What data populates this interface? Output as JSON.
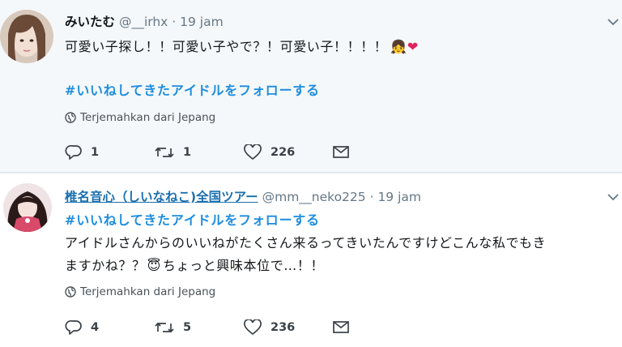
{
  "tweets": [
    {
      "display_name": "みいたむ",
      "handle": "@__irhx",
      "time": "· 19 jam",
      "text_line1": "可愛い子探し！！可愛い子やで？！可愛い子！！！！",
      "emoji_line1": "👧❤",
      "hashtag": "#いいねしてきたアイドルをフォローする",
      "translate_label": "Terjemahkan dari Jepang",
      "replies": "1",
      "retweets": "1",
      "likes": "226"
    },
    {
      "display_name": "椎名音心（しいなねこ)全国ツアー",
      "handle": "@mm__neko225",
      "time": "· 19 jam",
      "hashtag": "#いいねしてきたアイドルをフォローする",
      "text_line1": "アイドルさんからのいいねがたくさん来るってきいたんですけどこんな私でもき",
      "text_line2a": "ますかね？？",
      "emoji_line2": "😇",
      "text_line2b": "ちょっと興味本位で…！！",
      "translate_label": "Terjemahkan dari Jepang",
      "replies": "4",
      "retweets": "5",
      "likes": "236"
    }
  ],
  "icons": {
    "reply": "reply-icon",
    "retweet": "retweet-icon",
    "like": "heart-icon",
    "dm": "envelope-icon",
    "globe": "globe-icon",
    "more": "chevron-down-icon"
  },
  "colors": {
    "hashtag": "#1d8ddf",
    "name_link": "#1b6fae",
    "meta": "#657786",
    "like_red": "#e0245e"
  }
}
